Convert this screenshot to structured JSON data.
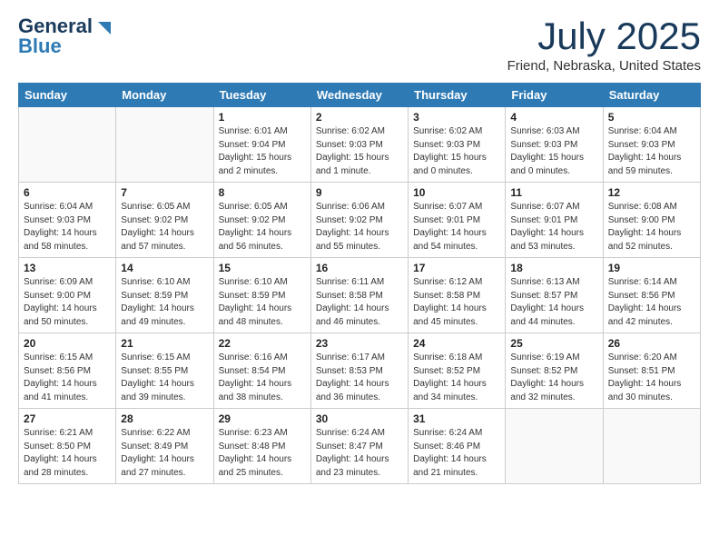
{
  "header": {
    "logo_general": "General",
    "logo_blue": "Blue",
    "title": "July 2025",
    "subtitle": "Friend, Nebraska, United States"
  },
  "weekdays": [
    "Sunday",
    "Monday",
    "Tuesday",
    "Wednesday",
    "Thursday",
    "Friday",
    "Saturday"
  ],
  "weeks": [
    [
      {
        "day": "",
        "info": ""
      },
      {
        "day": "",
        "info": ""
      },
      {
        "day": "1",
        "info": "Sunrise: 6:01 AM\nSunset: 9:04 PM\nDaylight: 15 hours\nand 2 minutes."
      },
      {
        "day": "2",
        "info": "Sunrise: 6:02 AM\nSunset: 9:03 PM\nDaylight: 15 hours\nand 1 minute."
      },
      {
        "day": "3",
        "info": "Sunrise: 6:02 AM\nSunset: 9:03 PM\nDaylight: 15 hours\nand 0 minutes."
      },
      {
        "day": "4",
        "info": "Sunrise: 6:03 AM\nSunset: 9:03 PM\nDaylight: 15 hours\nand 0 minutes."
      },
      {
        "day": "5",
        "info": "Sunrise: 6:04 AM\nSunset: 9:03 PM\nDaylight: 14 hours\nand 59 minutes."
      }
    ],
    [
      {
        "day": "6",
        "info": "Sunrise: 6:04 AM\nSunset: 9:03 PM\nDaylight: 14 hours\nand 58 minutes."
      },
      {
        "day": "7",
        "info": "Sunrise: 6:05 AM\nSunset: 9:02 PM\nDaylight: 14 hours\nand 57 minutes."
      },
      {
        "day": "8",
        "info": "Sunrise: 6:05 AM\nSunset: 9:02 PM\nDaylight: 14 hours\nand 56 minutes."
      },
      {
        "day": "9",
        "info": "Sunrise: 6:06 AM\nSunset: 9:02 PM\nDaylight: 14 hours\nand 55 minutes."
      },
      {
        "day": "10",
        "info": "Sunrise: 6:07 AM\nSunset: 9:01 PM\nDaylight: 14 hours\nand 54 minutes."
      },
      {
        "day": "11",
        "info": "Sunrise: 6:07 AM\nSunset: 9:01 PM\nDaylight: 14 hours\nand 53 minutes."
      },
      {
        "day": "12",
        "info": "Sunrise: 6:08 AM\nSunset: 9:00 PM\nDaylight: 14 hours\nand 52 minutes."
      }
    ],
    [
      {
        "day": "13",
        "info": "Sunrise: 6:09 AM\nSunset: 9:00 PM\nDaylight: 14 hours\nand 50 minutes."
      },
      {
        "day": "14",
        "info": "Sunrise: 6:10 AM\nSunset: 8:59 PM\nDaylight: 14 hours\nand 49 minutes."
      },
      {
        "day": "15",
        "info": "Sunrise: 6:10 AM\nSunset: 8:59 PM\nDaylight: 14 hours\nand 48 minutes."
      },
      {
        "day": "16",
        "info": "Sunrise: 6:11 AM\nSunset: 8:58 PM\nDaylight: 14 hours\nand 46 minutes."
      },
      {
        "day": "17",
        "info": "Sunrise: 6:12 AM\nSunset: 8:58 PM\nDaylight: 14 hours\nand 45 minutes."
      },
      {
        "day": "18",
        "info": "Sunrise: 6:13 AM\nSunset: 8:57 PM\nDaylight: 14 hours\nand 44 minutes."
      },
      {
        "day": "19",
        "info": "Sunrise: 6:14 AM\nSunset: 8:56 PM\nDaylight: 14 hours\nand 42 minutes."
      }
    ],
    [
      {
        "day": "20",
        "info": "Sunrise: 6:15 AM\nSunset: 8:56 PM\nDaylight: 14 hours\nand 41 minutes."
      },
      {
        "day": "21",
        "info": "Sunrise: 6:15 AM\nSunset: 8:55 PM\nDaylight: 14 hours\nand 39 minutes."
      },
      {
        "day": "22",
        "info": "Sunrise: 6:16 AM\nSunset: 8:54 PM\nDaylight: 14 hours\nand 38 minutes."
      },
      {
        "day": "23",
        "info": "Sunrise: 6:17 AM\nSunset: 8:53 PM\nDaylight: 14 hours\nand 36 minutes."
      },
      {
        "day": "24",
        "info": "Sunrise: 6:18 AM\nSunset: 8:52 PM\nDaylight: 14 hours\nand 34 minutes."
      },
      {
        "day": "25",
        "info": "Sunrise: 6:19 AM\nSunset: 8:52 PM\nDaylight: 14 hours\nand 32 minutes."
      },
      {
        "day": "26",
        "info": "Sunrise: 6:20 AM\nSunset: 8:51 PM\nDaylight: 14 hours\nand 30 minutes."
      }
    ],
    [
      {
        "day": "27",
        "info": "Sunrise: 6:21 AM\nSunset: 8:50 PM\nDaylight: 14 hours\nand 28 minutes."
      },
      {
        "day": "28",
        "info": "Sunrise: 6:22 AM\nSunset: 8:49 PM\nDaylight: 14 hours\nand 27 minutes."
      },
      {
        "day": "29",
        "info": "Sunrise: 6:23 AM\nSunset: 8:48 PM\nDaylight: 14 hours\nand 25 minutes."
      },
      {
        "day": "30",
        "info": "Sunrise: 6:24 AM\nSunset: 8:47 PM\nDaylight: 14 hours\nand 23 minutes."
      },
      {
        "day": "31",
        "info": "Sunrise: 6:24 AM\nSunset: 8:46 PM\nDaylight: 14 hours\nand 21 minutes."
      },
      {
        "day": "",
        "info": ""
      },
      {
        "day": "",
        "info": ""
      }
    ]
  ]
}
